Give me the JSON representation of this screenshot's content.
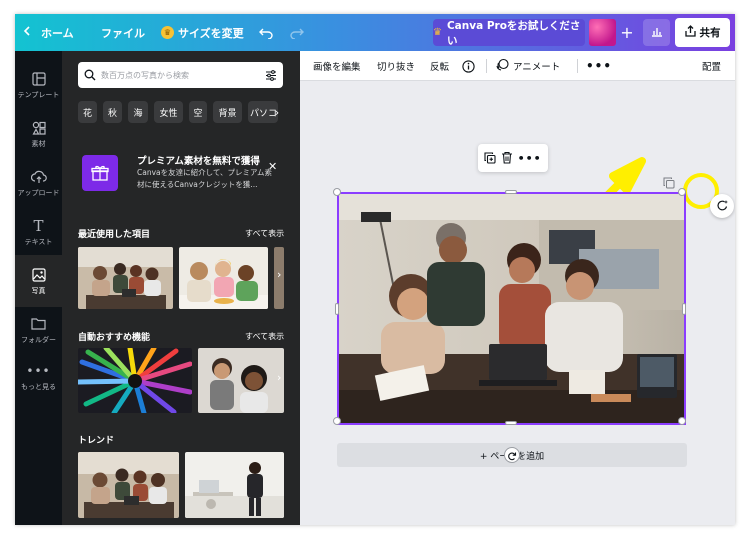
{
  "topbar": {
    "home_label": "ホーム",
    "file_label": "ファイル",
    "resize_label": "サイズを変更",
    "pro_label": "Canva Proをお試しください",
    "share_label": "共有"
  },
  "rail": {
    "items": [
      {
        "label": "テンプレート",
        "icon": "template-icon"
      },
      {
        "label": "素材",
        "icon": "elements-icon"
      },
      {
        "label": "アップロード",
        "icon": "upload-icon"
      },
      {
        "label": "テキスト",
        "icon": "text-icon"
      },
      {
        "label": "写真",
        "icon": "photo-icon"
      },
      {
        "label": "フォルダー",
        "icon": "folder-icon"
      },
      {
        "label": "もっと見る",
        "icon": "more-icon"
      }
    ]
  },
  "panel": {
    "search_placeholder": "数百万点の写真から検索",
    "chips": [
      "花",
      "秋",
      "海",
      "女性",
      "空",
      "背景",
      "パソコ"
    ],
    "promo": {
      "title": "プレミアム素材を無料で獲得",
      "body": "Canvaを友達に紹介して、プレミアム素材に使えるCanvaクレジットを獲..."
    },
    "sections": {
      "recent": {
        "title": "最近使用した項目",
        "see_all": "すべて表示"
      },
      "auto": {
        "title": "自動おすすめ機能",
        "see_all": "すべて表示"
      },
      "trend": {
        "title": "トレンド"
      }
    }
  },
  "editbar": {
    "edit_image": "画像を編集",
    "crop": "切り抜き",
    "flip": "反転",
    "animate": "アニメート",
    "arrange": "配置"
  },
  "canvas": {
    "add_page": "+ ページを追加"
  },
  "colors": {
    "accent": "#8b3dff",
    "annotation_arrow": "#ffef00",
    "panel_bg": "#252627",
    "rail_bg": "#0e1318"
  }
}
